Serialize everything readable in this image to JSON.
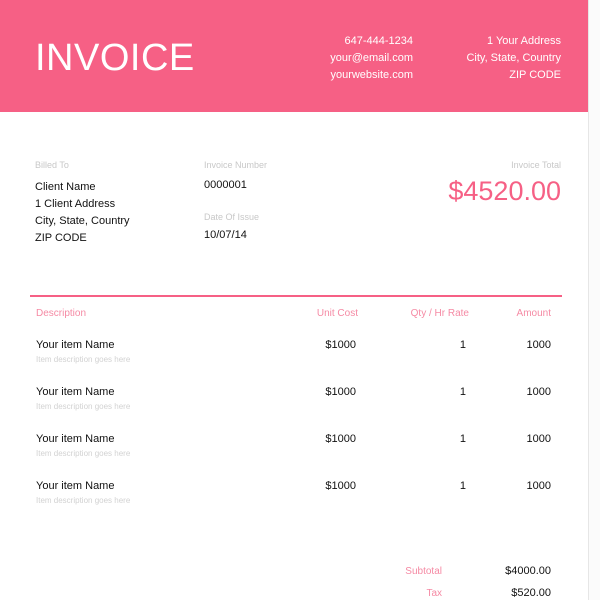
{
  "header": {
    "title": "INVOICE",
    "contact": {
      "phone": "647-444-1234",
      "email": "your@email.com",
      "website": "yourwebsite.com"
    },
    "address": {
      "line1": "1 Your Address",
      "line2": "City, State, Country",
      "line3": "ZIP CODE"
    },
    "color": "#f66085"
  },
  "billed_to": {
    "label": "Billed To",
    "name": "Client Name",
    "address": "1 Client Address",
    "city": "City, State, Country",
    "zip": "ZIP CODE"
  },
  "invoice_number": {
    "label": "Invoice Number",
    "value": "0000001"
  },
  "date_of_issue": {
    "label": "Date Of Issue",
    "value": "10/07/14"
  },
  "invoice_total": {
    "label": "Invoice Total",
    "value": "$4520.00"
  },
  "table": {
    "headers": {
      "description": "Description",
      "unit_cost": "Unit Cost",
      "qty": "Qty / Hr Rate",
      "amount": "Amount"
    },
    "rows": [
      {
        "name": "Your item Name",
        "sub": "Item description goes here",
        "unit_cost": "$1000",
        "qty": "1",
        "amount": "1000"
      },
      {
        "name": "Your item Name",
        "sub": "Item description goes here",
        "unit_cost": "$1000",
        "qty": "1",
        "amount": "1000"
      },
      {
        "name": "Your item Name",
        "sub": "Item description goes here",
        "unit_cost": "$1000",
        "qty": "1",
        "amount": "1000"
      },
      {
        "name": "Your item Name",
        "sub": "Item description goes here",
        "unit_cost": "$1000",
        "qty": "1",
        "amount": "1000"
      }
    ]
  },
  "summary": {
    "subtotal_label": "Subtotal",
    "subtotal_value": "$4000.00",
    "tax_label": "Tax",
    "tax_value": "$520.00"
  }
}
